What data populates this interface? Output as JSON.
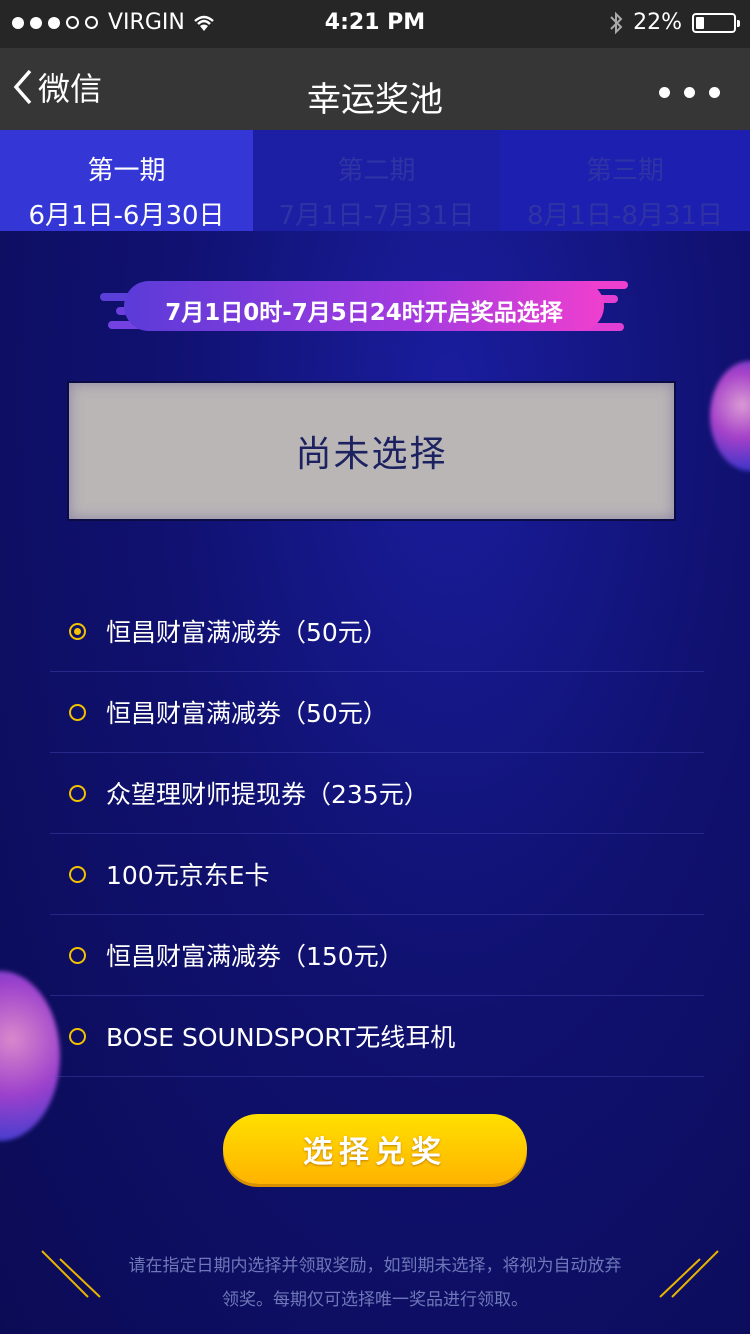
{
  "status_bar": {
    "carrier": "VIRGIN",
    "time": "4:21 PM",
    "battery": "22%",
    "signal_icons": [
      "dot-full",
      "dot-full",
      "dot-full",
      "dot-empty",
      "dot-empty"
    ],
    "wifi_icon": "wifi-icon",
    "bluetooth_icon": "bluetooth-icon"
  },
  "nav": {
    "back_label": "微信",
    "title": "幸运奖池"
  },
  "tabs": [
    {
      "name": "第一期",
      "dates": "6月1日-6月30日",
      "active": true
    },
    {
      "name": "第二期",
      "dates": "7月1日-7月31日",
      "active": false
    },
    {
      "name": "第三期",
      "dates": "8月1日-8月31日",
      "active": false
    }
  ],
  "banner": {
    "text": "7月1日0时-7月5日24时开启奖品选择"
  },
  "selection": {
    "text": "尚未选择"
  },
  "options": [
    {
      "label": "恒昌财富满减劵（50元）",
      "checked": true
    },
    {
      "label": "恒昌财富满减劵（50元）",
      "checked": false
    },
    {
      "label": "众望理财师提现券（235元）",
      "checked": false
    },
    {
      "label": "100元京东E卡",
      "checked": false
    },
    {
      "label": "恒昌财富满减劵（150元）",
      "checked": false
    },
    {
      "label": "BOSE SOUNDSPORT无线耳机",
      "checked": false
    }
  ],
  "submit": {
    "label": "选择兑奖"
  },
  "note": {
    "line1": "请在指定日期内选择并领取奖励，如到期未选择，将视为自动放弃",
    "line2": "领奖。每期仅可选择唯一奖品进行领取。"
  },
  "colors": {
    "accent_yellow": "#f2c200",
    "tab_active": "#3437d6",
    "background": "#10126a"
  }
}
